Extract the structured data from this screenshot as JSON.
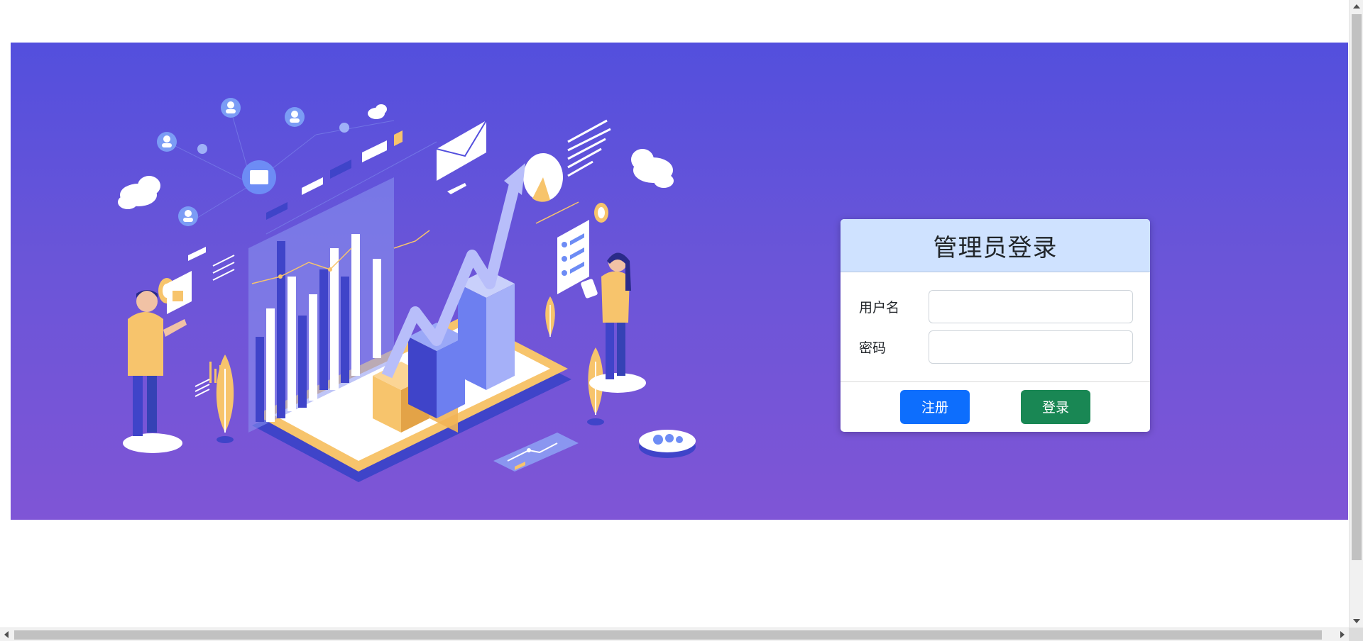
{
  "login": {
    "title": "管理员登录",
    "username_label": "用户名",
    "username_value": "",
    "password_label": "密码",
    "password_value": "",
    "register_label": "注册",
    "login_label": "登录"
  },
  "colors": {
    "banner_top": "#534fdd",
    "banner_bottom": "#7f55d6",
    "card_header": "#cfe2ff",
    "register_button": "#0d6efd",
    "login_button": "#198754"
  },
  "illustration": {
    "icons": [
      "person-icon",
      "cloud-icon",
      "envelope-icon",
      "pie-chart-icon",
      "bar-chart-icon",
      "growth-arrow-icon",
      "phone-icon",
      "plant-icon",
      "gear-icon"
    ]
  }
}
